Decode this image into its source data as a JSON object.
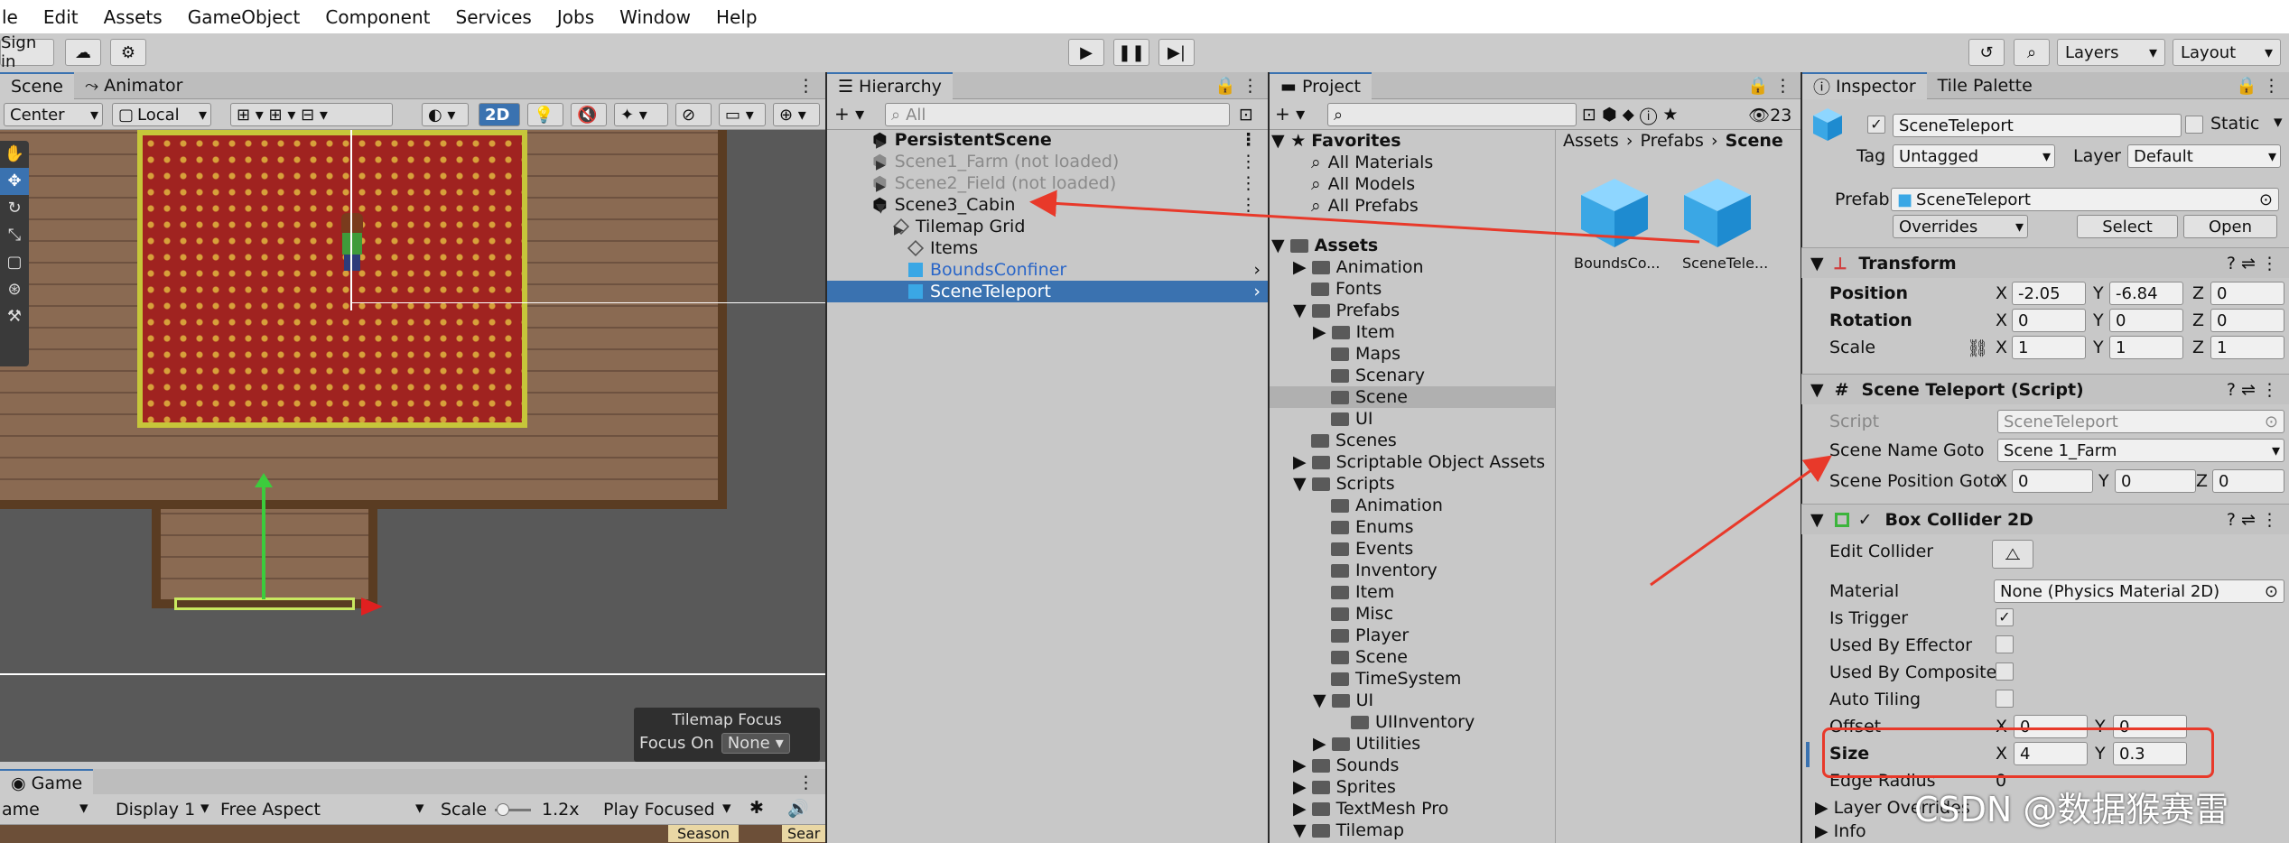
{
  "menu": [
    "le",
    "Edit",
    "Assets",
    "GameObject",
    "Component",
    "Services",
    "Jobs",
    "Window",
    "Help"
  ],
  "toolbar": {
    "sign_in": "Sign in",
    "layers": "Layers",
    "layout": "Layout"
  },
  "scene": {
    "tabs": [
      "Scene",
      "Animator"
    ],
    "pivot": "Center",
    "space": "Local",
    "mode2d": "2D",
    "tilemap_focus_title": "Tilemap Focus",
    "focus_on_label": "Focus On",
    "focus_on_value": "None"
  },
  "game": {
    "tab": "Game",
    "display": "ame",
    "display_num": "Display 1",
    "aspect": "Free Aspect",
    "scale_label": "Scale",
    "scale_value": "1.2x",
    "play_focused": "Play Focused",
    "hud_a": "Season",
    "hud_b": "Sear"
  },
  "hierarchy": {
    "tab": "Hierarchy",
    "search": "All",
    "items": [
      {
        "label": "PersistentScene"
      },
      {
        "label": "Scene1_Farm (not loaded)"
      },
      {
        "label": "Scene2_Field (not loaded)"
      },
      {
        "label": "Scene3_Cabin"
      },
      {
        "label": "Tilemap Grid"
      },
      {
        "label": "Items"
      },
      {
        "label": "BoundsConfiner"
      },
      {
        "label": "SceneTeleport"
      }
    ]
  },
  "project": {
    "tab": "Project",
    "count": "23",
    "favorites": [
      "Favorites",
      "All Materials",
      "All Models",
      "All Prefabs"
    ],
    "tree": [
      "Assets",
      "Animation",
      "Fonts",
      "Prefabs",
      "Item",
      "Maps",
      "Scenary",
      "Scene",
      "UI",
      "Scenes",
      "Scriptable Object Assets",
      "Scripts",
      "Animation",
      "Enums",
      "Events",
      "Inventory",
      "Item",
      "Misc",
      "Player",
      "Scene",
      "TimeSystem",
      "UI",
      "UIInventory",
      "Utilities",
      "Sounds",
      "Sprites",
      "TextMesh Pro",
      "Tilemap"
    ],
    "breadcrumb": [
      "Assets",
      "Prefabs",
      "Scene"
    ],
    "assets": [
      "BoundsCo...",
      "SceneTele..."
    ]
  },
  "inspector": {
    "tabs": [
      "Inspector",
      "Tile Palette"
    ],
    "name": "SceneTeleport",
    "static": "Static",
    "tag_label": "Tag",
    "tag": "Untagged",
    "layer_label": "Layer",
    "layer": "Default",
    "prefab_label": "Prefab",
    "prefab": "SceneTeleport",
    "overrides": "Overrides",
    "select": "Select",
    "open": "Open",
    "transform": {
      "title": "Transform",
      "position": "Position",
      "rotation": "Rotation",
      "scale": "Scale",
      "px": "-2.05",
      "py": "-6.84",
      "pz": "0",
      "rx": "0",
      "ry": "0",
      "rz": "0",
      "sx": "1",
      "sy": "1",
      "sz": "1"
    },
    "script": {
      "title": "Scene Teleport (Script)",
      "script_label": "Script",
      "script_value": "SceneTeleport",
      "goto_label": "Scene Name Goto",
      "goto_value": "Scene 1_Farm",
      "pos_label": "Scene Position Goto",
      "gx": "0",
      "gy": "0",
      "gz": "0"
    },
    "collider": {
      "title": "Box Collider 2D",
      "edit": "Edit Collider",
      "material_label": "Material",
      "material": "None (Physics Material 2D)",
      "trigger": "Is Trigger",
      "effector": "Used By Effector",
      "composite": "Used By Composite",
      "tiling": "Auto Tiling",
      "offset": "Offset",
      "ox": "0",
      "oy": "0",
      "size": "Size",
      "sx": "4",
      "sy": "0.3",
      "edge": "Edge Radius",
      "edge_val": "0"
    },
    "layer_overrides": "Layer Overrides",
    "info": "Info"
  },
  "axes": {
    "x": "X",
    "y": "Y",
    "z": "Z"
  },
  "watermark": "CSDN @数据猴赛雷"
}
